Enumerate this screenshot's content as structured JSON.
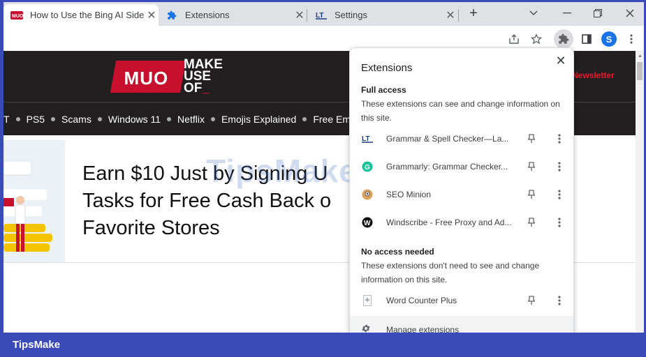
{
  "tabs": [
    {
      "title": "How to Use the Bing AI Sideb",
      "favicon": "muo-favicon",
      "active": true
    },
    {
      "title": "Extensions",
      "favicon": "puzzle-icon",
      "active": false
    },
    {
      "title": "Settings",
      "favicon": "lt-icon",
      "active": false
    }
  ],
  "window_controls": {
    "new_tab": "+",
    "dropdown": "⌄",
    "restore": "❐",
    "close": "✕"
  },
  "toolbar": {
    "avatar_letter": "S"
  },
  "site": {
    "logo_mark": "MUO",
    "logo_words": [
      "MAKE",
      "USE",
      "OF"
    ],
    "newsletter": "Newsletter",
    "nav": [
      "T",
      "PS5",
      "Scams",
      "Windows 11",
      "Netflix",
      "Emojis Explained",
      "Free Ema"
    ],
    "headline": "Earn $10 Just by Signing U\nTasks for Free Cash Back o\nFavorite Stores"
  },
  "watermark": "TipsMake",
  "popup": {
    "title": "Extensions",
    "full_access_title": "Full access",
    "full_access_desc": "These extensions can see and change information on this site.",
    "full_access_items": [
      {
        "name": "Grammar & Spell Checker—La...",
        "icon": "lt-icon"
      },
      {
        "name": "Grammarly: Grammar Checker...",
        "icon": "grammarly-icon"
      },
      {
        "name": "SEO Minion",
        "icon": "minion-icon"
      },
      {
        "name": "Windscribe - Free Proxy and Ad...",
        "icon": "windscribe-icon"
      }
    ],
    "no_access_title": "No access needed",
    "no_access_desc": "These extensions don't need to see and change information on this site.",
    "no_access_items": [
      {
        "name": "Word Counter Plus",
        "icon": "word-counter-icon"
      }
    ],
    "manage": "Manage extensions"
  },
  "brand": "TipsMake",
  "colors": {
    "accent": "#1a73e8",
    "muo_red": "#c8102e",
    "frame_blue": "#3a4ab8"
  }
}
